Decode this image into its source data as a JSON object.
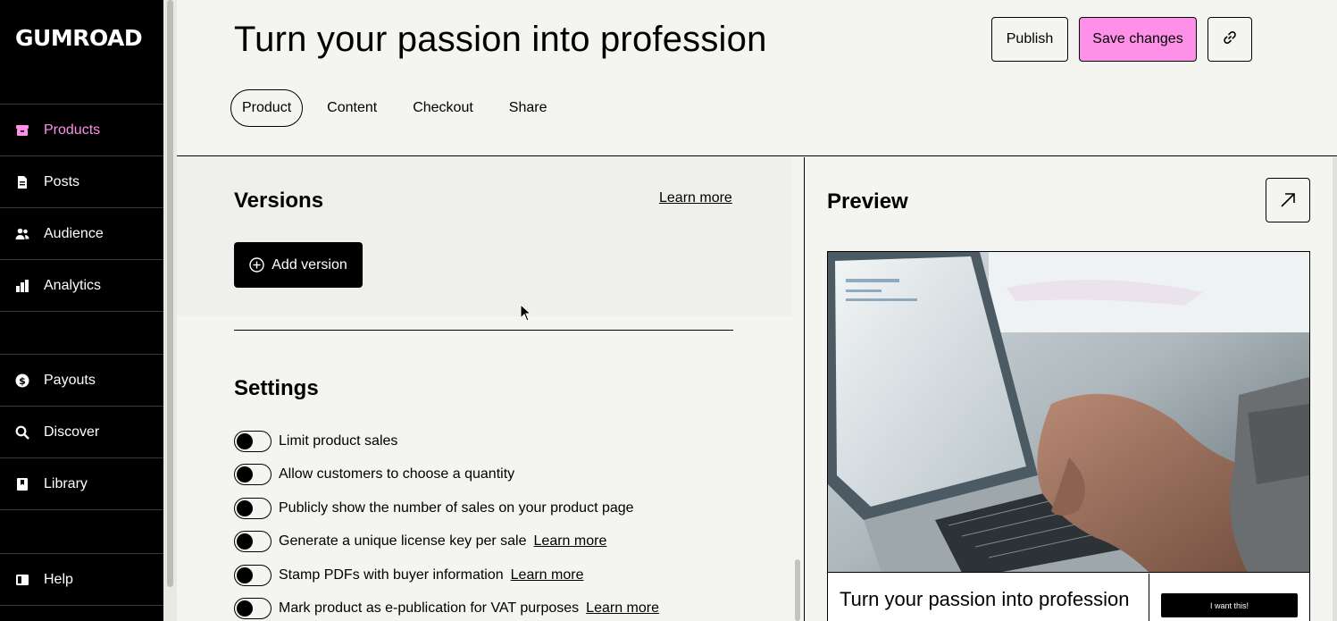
{
  "app": {
    "logo": "GUMROAD"
  },
  "sidebar": {
    "items": [
      {
        "label": "Products",
        "icon": "archive-icon",
        "active": true
      },
      {
        "label": "Posts",
        "icon": "document-icon"
      },
      {
        "label": "Audience",
        "icon": "people-icon"
      },
      {
        "label": "Analytics",
        "icon": "bar-chart-icon"
      },
      {
        "label": "Payouts",
        "icon": "dollar-circle-icon"
      },
      {
        "label": "Discover",
        "icon": "search-icon"
      },
      {
        "label": "Library",
        "icon": "bookmark-icon"
      },
      {
        "label": "Help",
        "icon": "book-icon"
      }
    ]
  },
  "header": {
    "title": "Turn your passion into profession",
    "publish_label": "Publish",
    "save_label": "Save changes",
    "tabs": [
      {
        "label": "Product",
        "active": true
      },
      {
        "label": "Content"
      },
      {
        "label": "Checkout"
      },
      {
        "label": "Share"
      }
    ]
  },
  "versions": {
    "heading": "Versions",
    "learn_more": "Learn more",
    "add_label": "Add version"
  },
  "settings": {
    "heading": "Settings",
    "items": [
      {
        "label": "Limit product sales",
        "link": "",
        "on": false
      },
      {
        "label": "Allow customers to choose a quantity",
        "link": "",
        "on": false
      },
      {
        "label": "Publicly show the number of sales on your product page",
        "link": "",
        "on": false
      },
      {
        "label": "Generate a unique license key per sale",
        "link": "Learn more",
        "on": false
      },
      {
        "label": "Stamp PDFs with buyer information",
        "link": "Learn more",
        "on": false
      },
      {
        "label": "Mark product as e-publication for VAT purposes",
        "link": "Learn more",
        "on": false
      }
    ]
  },
  "preview": {
    "heading": "Preview",
    "product_title": "Turn your passion into profession",
    "buy_label": "I want this!"
  },
  "colors": {
    "accent": "#ff90e8",
    "background": "#f4f4f0",
    "sidebar": "#000000"
  }
}
